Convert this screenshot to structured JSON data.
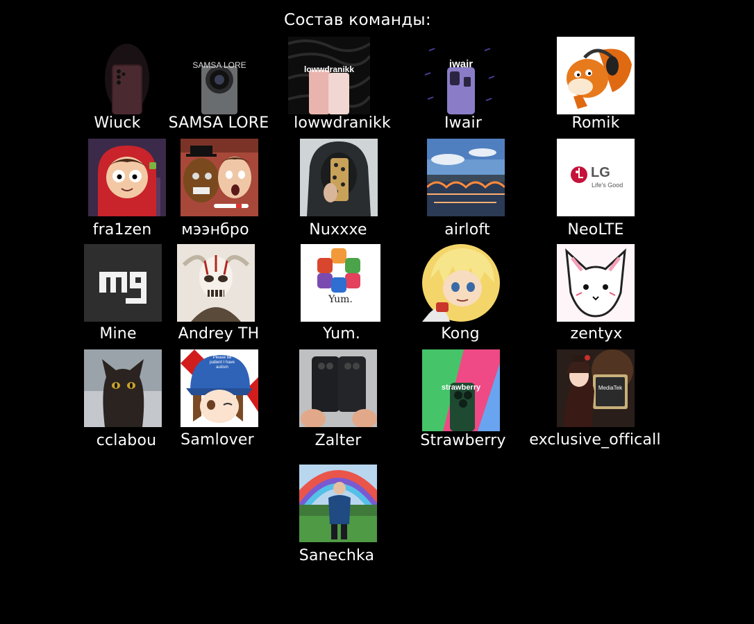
{
  "title": "Состав команды:",
  "members": [
    {
      "name": "Wiuck",
      "icon": "dark-phone-avatar"
    },
    {
      "name": "SAMSA LORE",
      "icon": "camera-phone-avatar",
      "logo_text": "SAMSA LORE"
    },
    {
      "name": "lowwdranikk",
      "icon": "pink-phone-avatar",
      "logo_text": "lowwdranikk"
    },
    {
      "name": "Iwair",
      "icon": "purple-phone-avatar",
      "logo_text": "iwair"
    },
    {
      "name": "Romik",
      "icon": "fox-headphones-avatar"
    },
    {
      "name": "fra1zen",
      "icon": "red-hoodie-cartoon-avatar"
    },
    {
      "name": "мээнбро",
      "icon": "animatronic-bear-avatar"
    },
    {
      "name": "Nuxxxe",
      "icon": "hooded-selfie-avatar"
    },
    {
      "name": "airloft",
      "icon": "bridge-river-avatar"
    },
    {
      "name": "NeoLTE",
      "icon": "lg-logo-avatar",
      "logo_text": "LG",
      "logo_tagline": "Life's Good"
    },
    {
      "name": "Mine",
      "icon": "mg-logo-avatar",
      "logo_text": "mg"
    },
    {
      "name": "Andrey TH",
      "icon": "skull-mask-avatar"
    },
    {
      "name": "Yum.",
      "icon": "colorful-macs-avatar",
      "logo_text": "Yum."
    },
    {
      "name": "Kong",
      "icon": "anime-boy-avatar"
    },
    {
      "name": "zentyx",
      "icon": "white-fox-sketch-avatar"
    },
    {
      "name": "cclabou",
      "icon": "black-cat-avatar"
    },
    {
      "name": "Samlover",
      "icon": "anime-girl-cap-avatar",
      "logo_text": "Please be patient I have autism"
    },
    {
      "name": "Zalter",
      "icon": "phones-in-hands-avatar"
    },
    {
      "name": "Strawberry",
      "icon": "green-phone-avatar",
      "logo_text": "strawberry"
    },
    {
      "name": "exclusive_officall",
      "icon": "mediatek-chip-avatar",
      "logo_text": "MediaTek"
    },
    {
      "name": "Sanechka",
      "icon": "presenter-rainbow-avatar"
    }
  ]
}
